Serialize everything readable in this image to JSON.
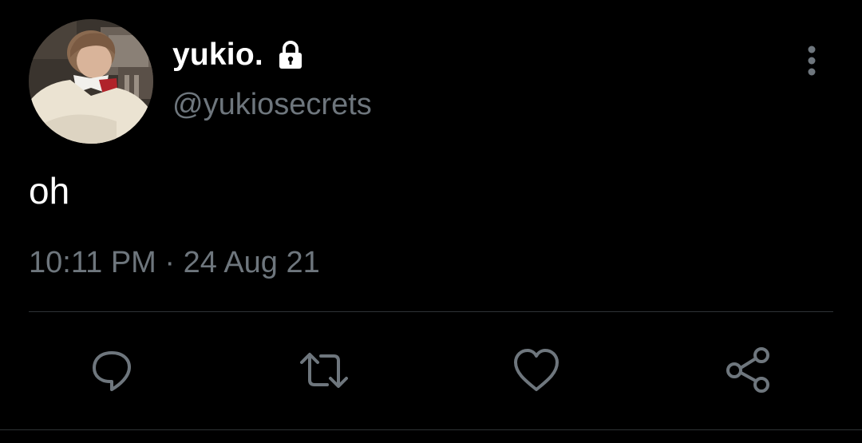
{
  "tweet": {
    "author": {
      "display_name": "yukio.",
      "handle": "@yukiosecrets",
      "protected_icon": "lock-icon",
      "avatar": "profile-photo"
    },
    "text": "oh",
    "timestamp": "10:11 PM · 24 Aug 21",
    "more_icon": "more-vertical-icon"
  },
  "actions": [
    {
      "name": "reply",
      "icon": "reply-icon"
    },
    {
      "name": "retweet",
      "icon": "retweet-icon"
    },
    {
      "name": "like",
      "icon": "heart-icon"
    },
    {
      "name": "share",
      "icon": "share-icon"
    }
  ],
  "colors": {
    "background": "#000000",
    "primary_text": "#ffffff",
    "secondary_text": "#6e767d",
    "divider": "#2f3336",
    "icon": "#6e767d"
  }
}
